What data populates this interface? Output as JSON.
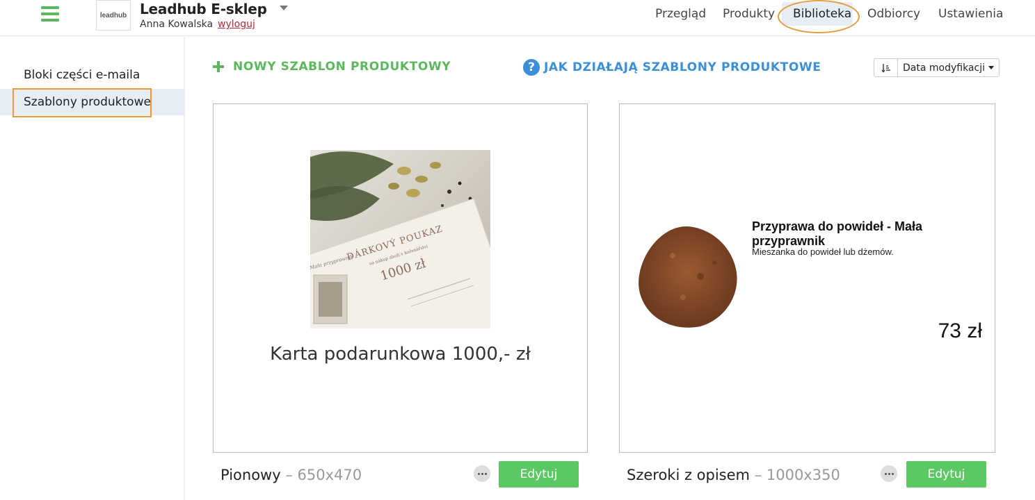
{
  "header": {
    "logo_text": "leadhub",
    "shop_name": "Leadhub E-sklep",
    "user_name": "Anna Kowalska",
    "logout_label": "wyloguj",
    "nav": {
      "przeglad": "Przegląd",
      "produkty": "Produkty",
      "biblioteka": "Biblioteka",
      "odbiorcy": "Odbiorcy",
      "ustawienia": "Ustawienia"
    },
    "active_nav": "Biblioteka"
  },
  "sidebar": {
    "items": [
      {
        "label": "Bloki części e-maila"
      },
      {
        "label": "Szablony produktowe"
      }
    ],
    "active_item": "Szablony produktowe"
  },
  "toolbar": {
    "new_template_label": "NOWY SZABLON PRODUKTOWY",
    "help_label": "JAK DZIAŁAJĄ SZABLONY PRODUKTOWE",
    "sort_label": "Data modyfikacji"
  },
  "templates": [
    {
      "name": "Pionowy",
      "dims": "– 650x470",
      "preview": {
        "caption": "Karta podarunkowa 1000,- zł",
        "voucher_heading": "DÁRKOVÝ POUKAZ",
        "voucher_sub": "na nákup zboží v kořenářství",
        "voucher_amount": "1000 zł",
        "voucher_brand": "Mała przyprawnik"
      },
      "edit_label": "Edytuj"
    },
    {
      "name": "Szeroki z opisem",
      "dims": "– 1000x350",
      "preview": {
        "title": "Przyprawa do powideł - Mała przyprawnik",
        "description": "Mieszanka do powideł lub dżemów.",
        "price": "73 zł"
      },
      "edit_label": "Edytuj"
    }
  ],
  "colors": {
    "brand_green": "#5cb85c",
    "link_blue": "#3a8fd8",
    "annotation_orange": "#e89a3c",
    "active_bg": "#e6edf5",
    "logout_red": "#b02a37"
  },
  "icons": {
    "menu": "hamburger-icon",
    "caret": "caret-down-icon",
    "plus": "plus-icon",
    "help": "question-circle-icon",
    "sort": "sort-amount-icon",
    "more": "ellipsis-icon"
  }
}
